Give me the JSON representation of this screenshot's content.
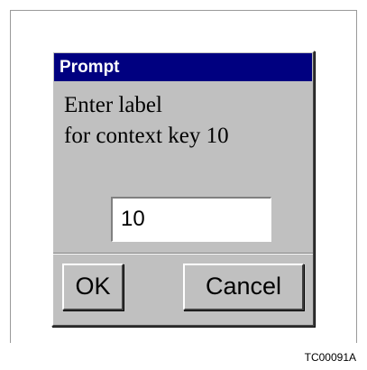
{
  "dialog": {
    "title": "Prompt",
    "message_line1": "Enter label",
    "message_line2": "for context key 10",
    "input_value": "10",
    "ok_label": "OK",
    "cancel_label": "Cancel"
  },
  "figure": {
    "caption": "TC00091A"
  },
  "colors": {
    "titlebar": "#000080",
    "dialog_bg": "#c0c0c0"
  }
}
